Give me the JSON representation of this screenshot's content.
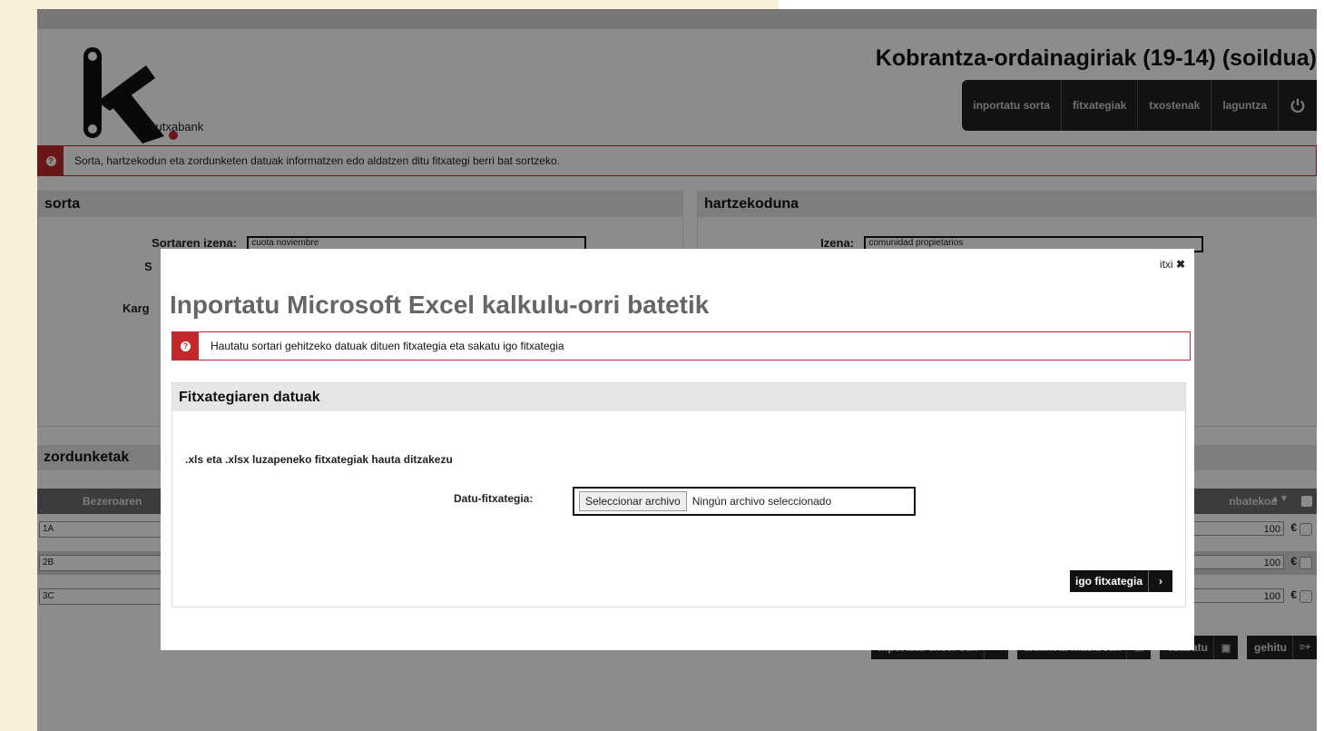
{
  "header": {
    "logo_text": "kutxabank",
    "page_title": "Kobrantza-ordainagiriak (19-14) (soildua)",
    "nav": [
      "inportatu sorta",
      "fitxategiak",
      "txostenak",
      "laguntza"
    ],
    "info_text": "Sorta, hartzekodun eta zordunketen datuak informatzen edo aldatzen ditu fitxategi berri bat sortzeko."
  },
  "sorta": {
    "title": "sorta",
    "name_label": "Sortaren izena:",
    "name_value": "cuota noviembre",
    "partial_label_1": "S",
    "partial_label_2": "Karg"
  },
  "hartzekoduna": {
    "title": "hartzekoduna",
    "name_label": "Izena:",
    "name_value": "comunidad propietarios"
  },
  "zordunketak": {
    "title": "zordunketak",
    "col_customer": "Bezeroaren",
    "col_amount": "nbatekoa",
    "rows": [
      {
        "id": "1A",
        "amount": "100",
        "currency": "€"
      },
      {
        "id": "2B",
        "amount": "100",
        "currency": "€"
      },
      {
        "id": "3C",
        "amount": "100",
        "currency": "€"
      }
    ]
  },
  "bottom_buttons": [
    "inportatu excel-etik",
    "aldaketa masiboak",
    "ezabatu",
    "gehitu"
  ],
  "modal": {
    "close_label": "itxi",
    "title": "Inportatu Microsoft Excel kalkulu-orri batetik",
    "info_text": "Hautatu sortari gehitzeko datuak dituen fitxategia eta sakatu igo fitxategia",
    "panel_title": "Fitxategiaren datuak",
    "note": ".xls eta .xlsx luzapeneko fitxategiak hauta ditzakezu",
    "file_label": "Datu-fitxategia:",
    "file_button": "Seleccionar archivo",
    "file_status": "Ningún archivo seleccionado",
    "upload_label": "igo fitxategia"
  },
  "colors": {
    "accent_red": "#c0282c",
    "nav_dark": "#222222",
    "overlay": "rgba(0,0,0,0.45)"
  }
}
